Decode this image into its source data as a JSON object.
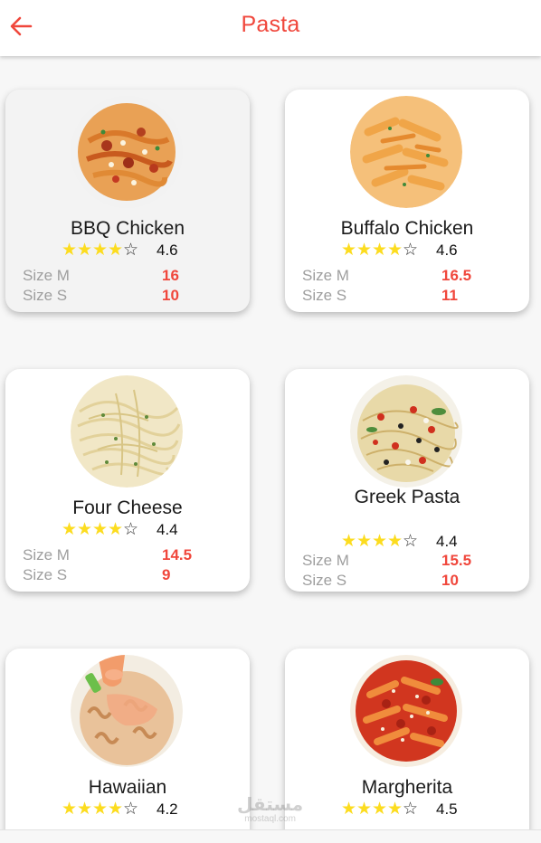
{
  "app": {
    "title": "Pasta"
  },
  "items": [
    {
      "name": "BBQ Chicken",
      "rating": "4.6",
      "stars": 4,
      "sizes": [
        {
          "label": "Size M",
          "price": "16"
        },
        {
          "label": "Size S",
          "price": "10"
        }
      ]
    },
    {
      "name": "Buffalo Chicken",
      "rating": "4.6",
      "stars": 4,
      "sizes": [
        {
          "label": "Size M",
          "price": "16.5"
        },
        {
          "label": "Size S",
          "price": "11"
        }
      ]
    },
    {
      "name": "Four Cheese",
      "rating": "4.4",
      "stars": 4,
      "sizes": [
        {
          "label": "Size M",
          "price": "14.5"
        },
        {
          "label": "Size S",
          "price": "9"
        }
      ]
    },
    {
      "name": "Greek Pasta",
      "rating": "4.4",
      "stars": 4,
      "sizes": [
        {
          "label": "Size M",
          "price": "15.5"
        },
        {
          "label": "Size S",
          "price": "10"
        }
      ]
    },
    {
      "name": "Hawaiian",
      "rating": "4.2",
      "stars": 4,
      "sizes": []
    },
    {
      "name": "Margherita",
      "rating": "4.5",
      "stars": 4,
      "sizes": []
    }
  ],
  "icons": {
    "back": "arrow-left-icon",
    "star_filled": "star-filled-icon",
    "star_empty": "star-outline-icon"
  },
  "colors": {
    "accent": "#f0473c",
    "star": "#fcdc1f",
    "muted_text": "#9e9e9e"
  },
  "watermark": {
    "text": "مستقل",
    "domain": "mostaql.com"
  }
}
